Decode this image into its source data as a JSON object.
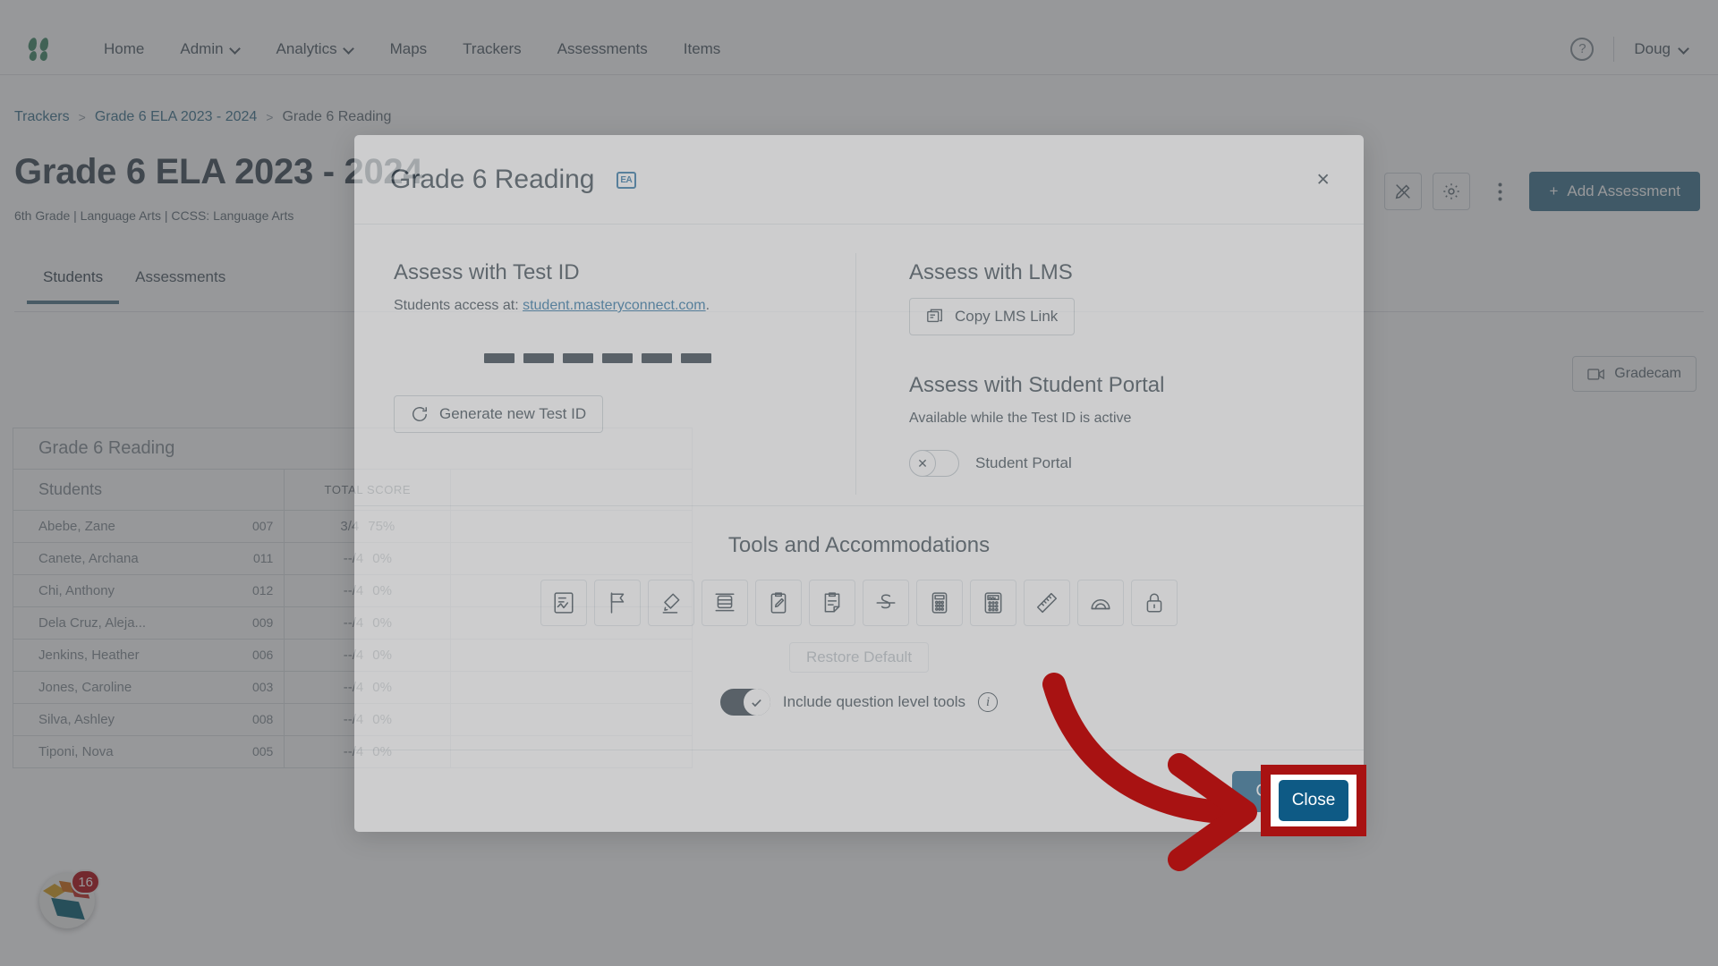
{
  "nav": {
    "logo": "masteryconnect-logo",
    "items": [
      {
        "label": "Home",
        "has_caret": false
      },
      {
        "label": "Admin",
        "has_caret": true
      },
      {
        "label": "Analytics",
        "has_caret": true
      },
      {
        "label": "Maps",
        "has_caret": false
      },
      {
        "label": "Trackers",
        "has_caret": false
      },
      {
        "label": "Assessments",
        "has_caret": false
      },
      {
        "label": "Items",
        "has_caret": false
      }
    ],
    "help_label": "?",
    "user": "Doug"
  },
  "breadcrumb": {
    "items": [
      "Trackers",
      "Grade 6 ELA 2023 - 2024",
      "Grade 6 Reading"
    ],
    "separator": ">"
  },
  "page": {
    "title": "Grade 6 ELA 2023 - 2024",
    "subtitle": "6th Grade  |  Language Arts  |  CCSS: Language Arts",
    "add_assessment": "Add Assessment",
    "plus": "+",
    "gradecam": "Gradecam",
    "tabs": [
      {
        "label": "Students",
        "active": true
      },
      {
        "label": "Assessments",
        "active": false
      }
    ]
  },
  "grid": {
    "assessment_name": "Grade 6 Reading",
    "col_students": "Students",
    "col_total_score": "TOTAL SCORE",
    "rows": [
      {
        "name": "Abebe, Zane",
        "id": "007",
        "score": "3/4",
        "pct": "75%"
      },
      {
        "name": "Canete, Archana",
        "id": "011",
        "score": "--/4",
        "pct": "0%"
      },
      {
        "name": "Chi, Anthony",
        "id": "012",
        "score": "--/4",
        "pct": "0%"
      },
      {
        "name": "Dela Cruz, Aleja...",
        "id": "009",
        "score": "--/4",
        "pct": "0%"
      },
      {
        "name": "Jenkins, Heather",
        "id": "006",
        "score": "--/4",
        "pct": "0%"
      },
      {
        "name": "Jones, Caroline",
        "id": "003",
        "score": "--/4",
        "pct": "0%"
      },
      {
        "name": "Silva, Ashley",
        "id": "008",
        "score": "--/4",
        "pct": "0%"
      },
      {
        "name": "Tiponi, Nova",
        "id": "005",
        "score": "--/4",
        "pct": "0%"
      }
    ]
  },
  "chat": {
    "badge_count": "16"
  },
  "modal": {
    "title": "Grade 6 Reading",
    "badge": "EA",
    "close_x": "×",
    "test_id": {
      "heading": "Assess with Test ID",
      "access_prefix": "Students access at: ",
      "link": "student.masteryconnect.com",
      "access_suffix": ".",
      "code_masked": "— — — — — —",
      "code_segments": 6,
      "generate_button": "Generate new Test ID"
    },
    "lms": {
      "heading": "Assess with LMS",
      "copy_button": "Copy LMS Link"
    },
    "student_portal": {
      "heading": "Assess with Student Portal",
      "note": "Available while the Test ID is active",
      "toggle_label": "Student Portal",
      "toggle_state": "off",
      "toggle_glyph": "✕"
    },
    "tools": {
      "heading": "Tools and Accommodations",
      "items": [
        {
          "name": "answer-eliminator-icon"
        },
        {
          "name": "flag-icon"
        },
        {
          "name": "highlighter-icon"
        },
        {
          "name": "line-reader-icon"
        },
        {
          "name": "notepad-pencil-icon"
        },
        {
          "name": "sticky-note-icon"
        },
        {
          "name": "strikethrough-icon"
        },
        {
          "name": "basic-calculator-icon"
        },
        {
          "name": "scientific-calculator-icon"
        },
        {
          "name": "ruler-icon"
        },
        {
          "name": "protractor-icon"
        },
        {
          "name": "lock-icon"
        }
      ],
      "restore_default": "Restore Default",
      "question_level_label": "Include question level tools",
      "question_level_state": "on",
      "info_glyph": "i"
    },
    "footer": {
      "close_button": "Close"
    }
  },
  "annotation": {
    "highlight_target": "Close",
    "highlight_color": "#a81212",
    "arrow_color": "#a81212"
  },
  "colors": {
    "brand_green": "#4b8f6f",
    "link_blue": "#1d6a9c",
    "primary_blue": "#0e5a85",
    "accent_slate": "#4a7c94",
    "annotation_red": "#a81212"
  }
}
